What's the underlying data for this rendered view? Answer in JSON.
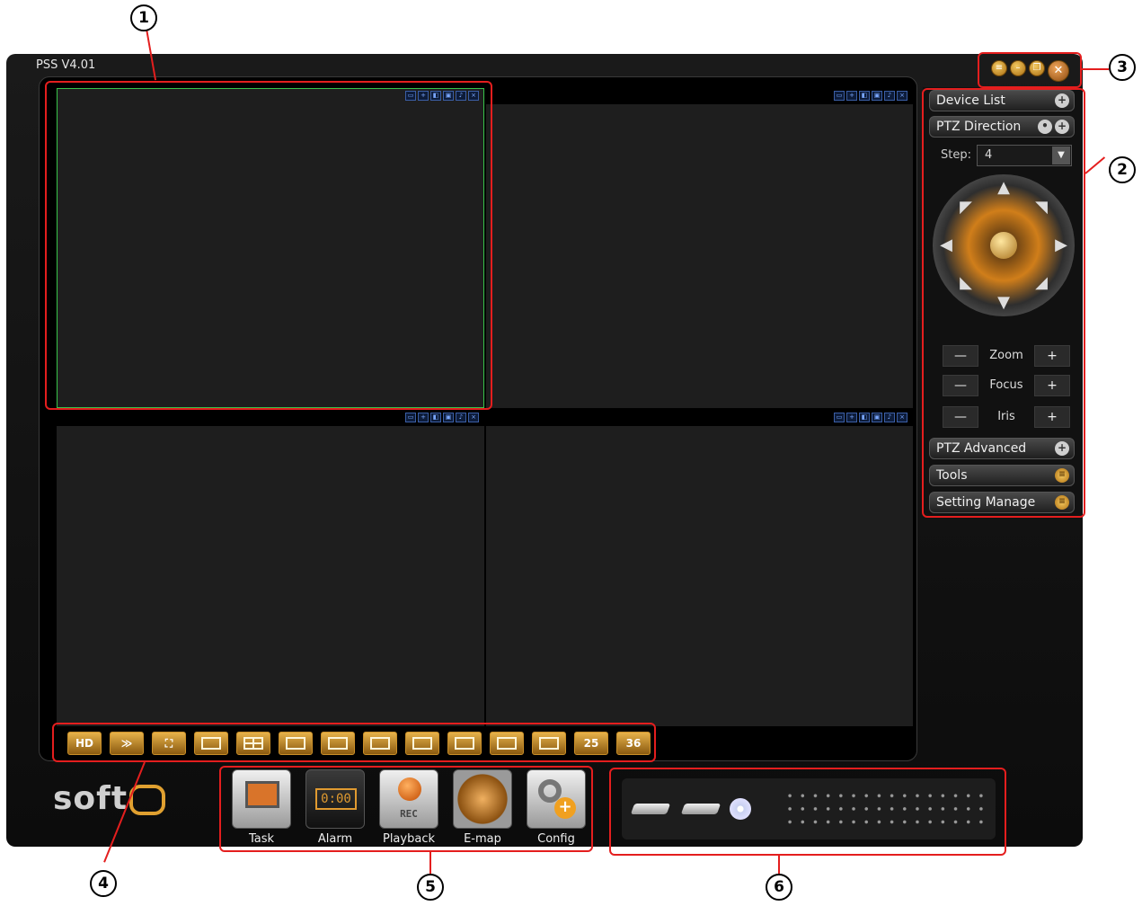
{
  "app": {
    "title": "PSS  V4.01"
  },
  "window_controls": {
    "menu_icon": "menu-icon",
    "minimize_icon": "minimize-icon",
    "restore_icon": "restore-icon",
    "close_icon": "close-icon"
  },
  "side_panel": {
    "device_list": "Device List",
    "ptz_direction": "PTZ Direction",
    "step_label": "Step:",
    "step_value": "4",
    "zoom": "Zoom",
    "focus": "Focus",
    "iris": "Iris",
    "minus": "—",
    "plus": "+",
    "ptz_advanced": "PTZ Advanced",
    "tools": "Tools",
    "setting_manage": "Setting Manage"
  },
  "layout_buttons": [
    "HD",
    "",
    "",
    "",
    "",
    "",
    "",
    "",
    "",
    "",
    "",
    "",
    "25",
    "36"
  ],
  "dock": {
    "task": "Task",
    "alarm": "Alarm",
    "alarm_display": "0:00",
    "playback": "Playback",
    "playback_tag": "REC",
    "emap": "E-map",
    "config": "Config"
  },
  "logo": {
    "text": "soft"
  },
  "callouts": {
    "c1": "1",
    "c2": "2",
    "c3": "3",
    "c4": "4",
    "c5": "5",
    "c6": "6"
  },
  "colors": {
    "accent": "#e0a030",
    "active_cell": "#39c44a",
    "callout": "#e41e1e"
  }
}
